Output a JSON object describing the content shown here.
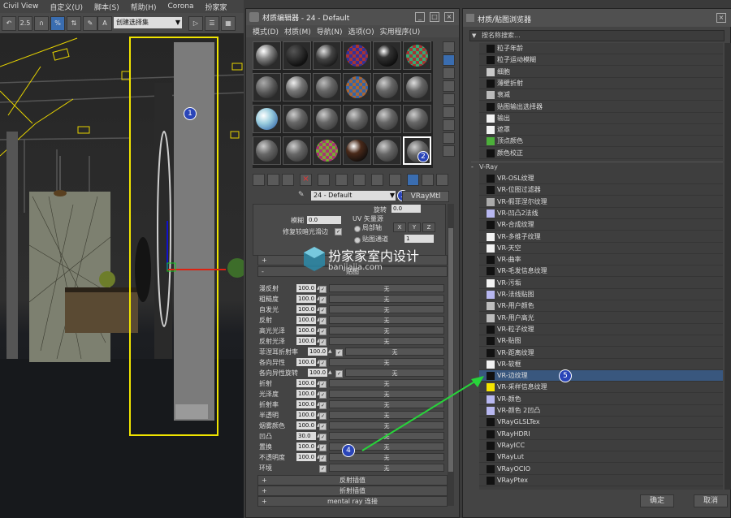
{
  "main": {
    "menus": [
      "Civil View",
      "自定义(U)",
      "脚本(S)",
      "帮助(H)",
      "Corona",
      "扮家家"
    ],
    "toolbar": {
      "spinner_label": "2.5",
      "selection_set_placeholder": "创建选择集"
    },
    "markers": [
      "1",
      "2",
      "3",
      "4",
      "5"
    ]
  },
  "material_editor": {
    "title": "材质编辑器 - 24 - Default",
    "menus": [
      "模式(D)",
      "材质(M)",
      "导航(N)",
      "选项(O)",
      "实用程序(U)"
    ],
    "material_name": "24 - Default",
    "material_type": "VRayMtl",
    "rollout_top": {
      "blur_label": "模糊",
      "blur_value": "0.0",
      "rotation_label": "旋转",
      "rotation_value": "0.0",
      "fix_dark_label": "修复较暗光滑边",
      "uv_label": "UV 矢量源",
      "local_axis_label": "局部轴",
      "x_label": "X",
      "y_label": "Y",
      "z_label": "Z",
      "map_channel_label": "贴图通道",
      "map_channel_value": "1"
    },
    "maps_rollout_label": "贴图",
    "none_label": "无",
    "maps": [
      {
        "name": "漫反射",
        "amount": "100.0"
      },
      {
        "name": "粗糙度",
        "amount": "100.0"
      },
      {
        "name": "自发光",
        "amount": "100.0"
      },
      {
        "name": "反射",
        "amount": "100.0"
      },
      {
        "name": "高光光泽",
        "amount": "100.0"
      },
      {
        "name": "反射光泽",
        "amount": "100.0"
      },
      {
        "name": "菲涅耳折射率",
        "amount": "100.0"
      },
      {
        "name": "各向异性",
        "amount": "100.0"
      },
      {
        "name": "各向异性旋转",
        "amount": "100.0"
      },
      {
        "name": "折射",
        "amount": "100.0"
      },
      {
        "name": "光泽度",
        "amount": "100.0"
      },
      {
        "name": "折射率",
        "amount": "100.0"
      },
      {
        "name": "半透明",
        "amount": "100.0"
      },
      {
        "name": "烟雾颜色",
        "amount": "100.0"
      },
      {
        "name": "凹凸",
        "amount": "30.0"
      },
      {
        "name": "置换",
        "amount": "100.0"
      },
      {
        "name": "不透明度",
        "amount": "100.0"
      },
      {
        "name": "环境",
        "amount": ""
      }
    ],
    "rollouts_bottom": [
      "反射插值",
      "折射插值",
      "mental ray 连接"
    ]
  },
  "watermark": {
    "brand": "扮家家室内设计",
    "url": "banjiajia.com"
  },
  "browser": {
    "title": "材质/贴图浏览器",
    "search_placeholder": "按名称搜索...",
    "top_items": [
      {
        "name": "粒子年龄",
        "swatch": "#111111"
      },
      {
        "name": "粒子运动模糊",
        "swatch": "#111111"
      },
      {
        "name": "细胞",
        "swatch": "#c8c8c8"
      },
      {
        "name": "薄壁折射",
        "swatch": "#111111"
      },
      {
        "name": "衰减",
        "swatch": "#bbbbbb"
      },
      {
        "name": "贴图输出选择器",
        "swatch": "#111111"
      },
      {
        "name": "输出",
        "swatch": "#f2f2f2"
      },
      {
        "name": "遮罩",
        "swatch": "#f2f2f2"
      },
      {
        "name": "顶点颜色",
        "swatch": "#4caf3a"
      },
      {
        "name": "颜色校正",
        "swatch": "#111111"
      }
    ],
    "group_label": "V-Ray",
    "vray_items": [
      {
        "name": "VR-OSL纹理",
        "swatch": "#111111"
      },
      {
        "name": "VR-位图过滤器",
        "swatch": "#111111"
      },
      {
        "name": "VR-假菲涅尔纹理",
        "swatch": "#aaaaaa"
      },
      {
        "name": "VR-凹凸2法线",
        "swatch": "#b7b7f0"
      },
      {
        "name": "VR-合成纹理",
        "swatch": "#111111"
      },
      {
        "name": "VR-多维子纹理",
        "swatch": "#f2f2f2"
      },
      {
        "name": "VR-天空",
        "swatch": "#f2f2f2"
      },
      {
        "name": "VR-曲率",
        "swatch": "#111111"
      },
      {
        "name": "VR-毛发信息纹理",
        "swatch": "#111111"
      },
      {
        "name": "VR-污垢",
        "swatch": "#f2f2f2"
      },
      {
        "name": "VR-法线贴图",
        "swatch": "#b7b7f0"
      },
      {
        "name": "VR-用户颜色",
        "swatch": "#bdbdbd"
      },
      {
        "name": "VR-用户高光",
        "swatch": "#bdbdbd"
      },
      {
        "name": "VR-粒子纹理",
        "swatch": "#111111"
      },
      {
        "name": "VR-贴图",
        "swatch": "#111111"
      },
      {
        "name": "VR-距离纹理",
        "swatch": "#111111"
      },
      {
        "name": "VR-软框",
        "swatch": "#f2f2f2"
      },
      {
        "name": "VR-边纹理",
        "swatch": "#111111",
        "selected": true
      },
      {
        "name": "VR-采样信息纹理",
        "swatch": "#f5e400"
      },
      {
        "name": "VR-颜色",
        "swatch": "#b7b7f0"
      },
      {
        "name": "VR-颜色 2凹凸",
        "swatch": "#b7b7f0"
      },
      {
        "name": "VRayGLSLTex",
        "swatch": "#111111"
      },
      {
        "name": "VRayHDRI",
        "swatch": "#111111"
      },
      {
        "name": "VRayICC",
        "swatch": "#111111"
      },
      {
        "name": "VRayLut",
        "swatch": "#111111"
      },
      {
        "name": "VRayOCIO",
        "swatch": "#111111"
      },
      {
        "name": "VRayPtex",
        "swatch": "#111111"
      }
    ],
    "ok_label": "确定",
    "cancel_label": "取消"
  }
}
